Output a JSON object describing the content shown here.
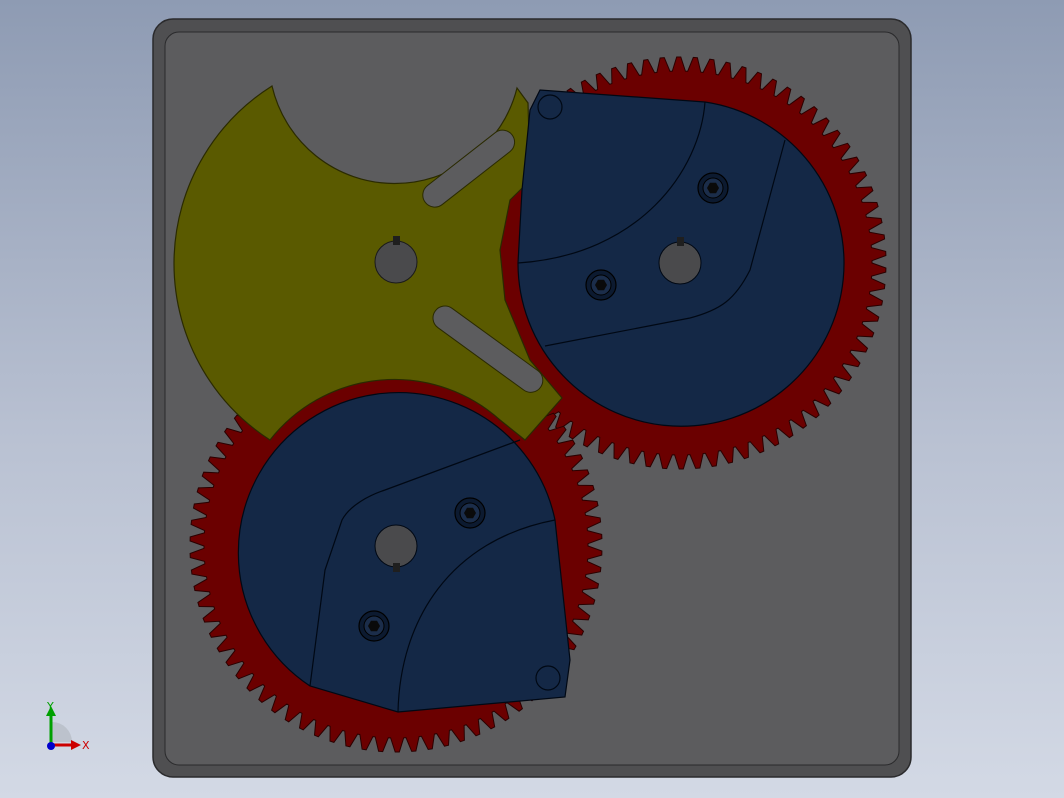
{
  "colors": {
    "background_top": "#8e9bb3",
    "background_bottom": "#d3d9e5",
    "base_plate": "#5c5c5e",
    "base_plate_edge": "#2a2a2c",
    "gear": "#6b0000",
    "gear_edge": "#2a0000",
    "cam_plate": "#5a5a00",
    "cam_plate_edge": "#2a2a00",
    "disc": "#142846",
    "disc_edge": "#000814",
    "bore": "#4a4a4c",
    "axis_x": "#cc0000",
    "axis_y": "#00a000",
    "axis_z": "#0000cc"
  },
  "triad": {
    "x_label": "X",
    "y_label": "Y"
  },
  "icons": {
    "triad": "coordinate-triad-icon",
    "hex_bolt": "hex-socket-bolt-icon"
  }
}
